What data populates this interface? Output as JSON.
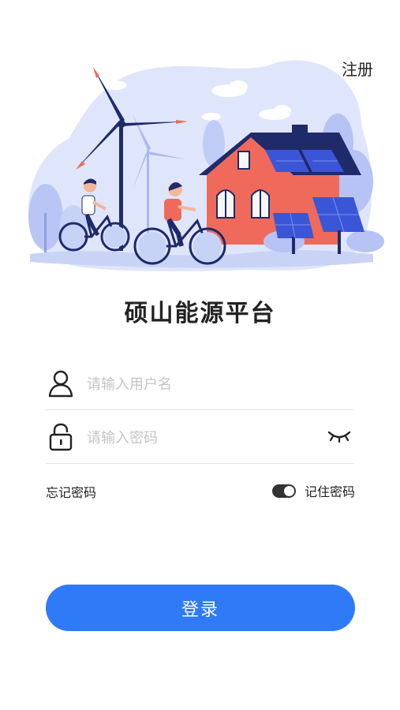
{
  "header": {
    "register_label": "注册"
  },
  "app": {
    "title": "硕山能源平台"
  },
  "form": {
    "username_placeholder": "请输入用户名",
    "username_value": "",
    "password_placeholder": "请输入密码",
    "password_value": ""
  },
  "options": {
    "forgot_label": "忘记密码",
    "remember_label": "记住密码",
    "remember_enabled": true
  },
  "login": {
    "label": "登录"
  },
  "colors": {
    "accent": "#2f7af7",
    "house": "#ef6a5b",
    "roof": "#1f2a6b",
    "panel": "#3a56d6",
    "backdrop": "#dde4fb"
  },
  "icons": {
    "user": "user-icon",
    "lock": "lock-icon",
    "eye": "eye-closed-icon"
  }
}
